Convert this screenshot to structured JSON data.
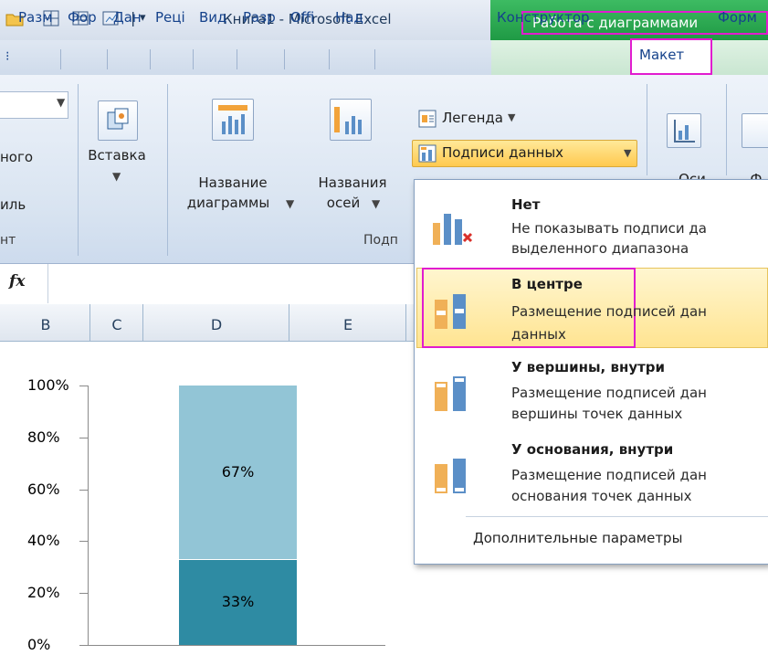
{
  "titlebar": {
    "title": "Книга1  -  Microsoft Excel",
    "context_group": "Работа с диаграммами"
  },
  "tabs": [
    "Разм",
    "Фор",
    "Дан",
    "Реці",
    "Вид",
    "Разр",
    "Offi",
    "Над"
  ],
  "context_tabs": {
    "konstruktor": "Конструктор",
    "maket": "Макет",
    "format": "Форм"
  },
  "ribbon": {
    "left_cut": {
      "line1": "ного",
      "line2": "иль",
      "group": "нт"
    },
    "insert": "Вставка",
    "chart_title": {
      "line1": "Название",
      "line2": "диаграммы"
    },
    "axis_titles": {
      "line1": "Названия",
      "line2": "осей"
    },
    "group_labels": "Подп",
    "legend": "Легенда",
    "data_labels": "Подписи данных",
    "axes": "Оси",
    "cut_right": "Ф"
  },
  "columns": [
    "B",
    "C",
    "D",
    "E"
  ],
  "chart_data": {
    "type": "bar",
    "stacked": true,
    "categories": [
      ""
    ],
    "series": [
      {
        "values": [
          33
        ],
        "color": "#2e8ba3"
      },
      {
        "values": [
          67
        ],
        "color": "#92c5d6"
      }
    ],
    "data_labels": [
      "33%",
      "67%"
    ],
    "ytick_labels": [
      "100%",
      "80%",
      "60%",
      "40%",
      "20%",
      "0%"
    ],
    "ylim": [
      0,
      100
    ]
  },
  "dropdown": {
    "items": [
      {
        "title": "Нет",
        "desc1": "Не показывать подписи да",
        "desc2": "выделенного диапазона"
      },
      {
        "title": "В центре",
        "desc1": "Размещение подписей дан",
        "desc2": "данных"
      },
      {
        "title": "У вершины, внутри",
        "desc1": "Размещение подписей дан",
        "desc2": "вершины точек данных"
      },
      {
        "title": "У основания, внутри",
        "desc1": "Размещение подписей дан",
        "desc2": "основания точек данных"
      }
    ],
    "more": "Дополнительные параметры"
  }
}
